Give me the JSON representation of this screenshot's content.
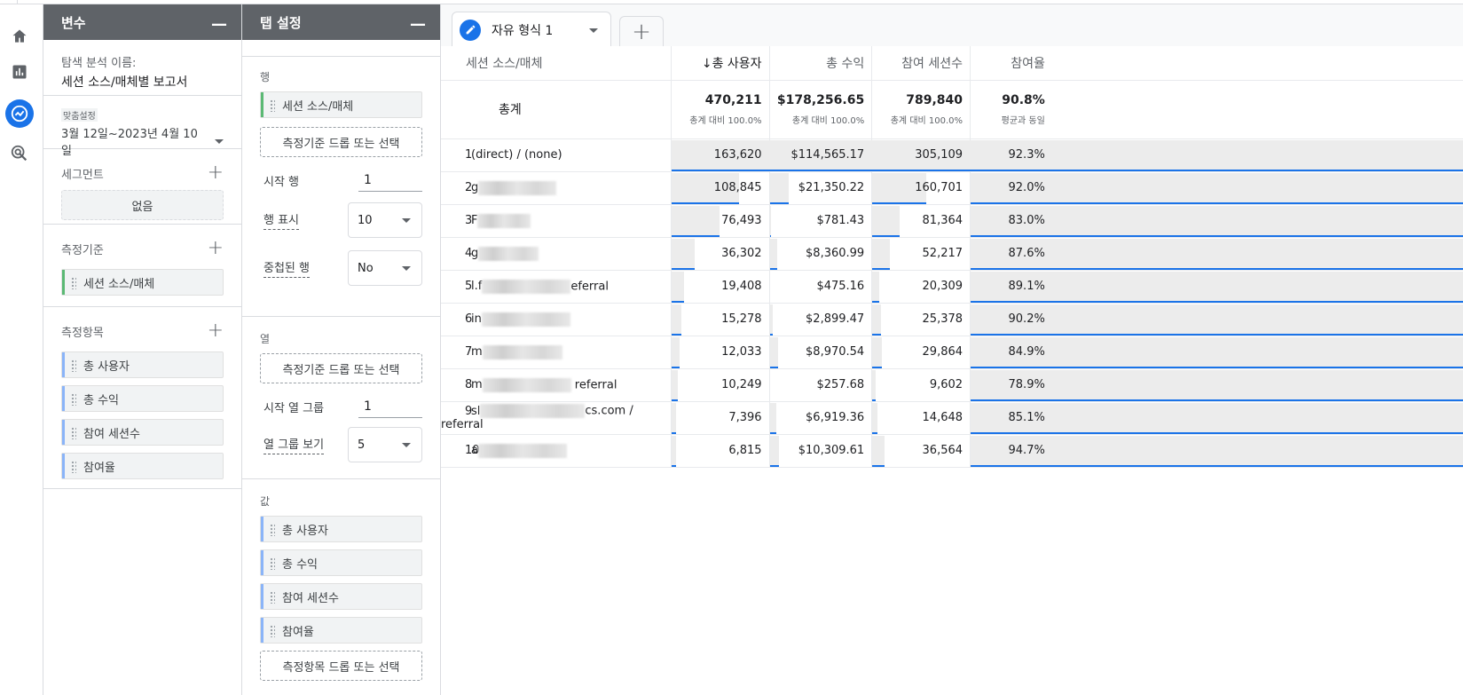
{
  "rail": {
    "items": [
      {
        "icon": "home-icon"
      },
      {
        "icon": "reports-icon"
      },
      {
        "icon": "explore-icon",
        "active": true
      },
      {
        "icon": "advertising-icon"
      }
    ]
  },
  "variables_panel": {
    "title": "변수",
    "collapse": "—",
    "exploration_name_label": "탐색 분석 이름:",
    "exploration_name": "세션 소스/매체별 보고서",
    "date_custom_label": "맞춤설정",
    "date_range": "3월 12일~2023년 4월 10일",
    "segments_label": "세그먼트",
    "segments_empty": "없음",
    "dimensions_label": "측정기준",
    "dimensions": [
      "세션 소스/매체"
    ],
    "metrics_label": "측정항목",
    "metrics": [
      "총 사용자",
      "총 수익",
      "참여 세션수",
      "참여율"
    ]
  },
  "tab_settings_panel": {
    "title": "탭 설정",
    "collapse": "—",
    "rows_label": "행",
    "rows_chip": "세션 소스/매체",
    "drop_dimension": "측정기준 드롭 또는 선택",
    "start_row_label": "시작 행",
    "start_row_value": "1",
    "show_rows_label": "행 표시",
    "show_rows_value": "10",
    "nested_rows_label": "중첩된 행",
    "nested_rows_value": "No",
    "columns_label": "열",
    "drop_dimension_col": "측정기준 드롭 또는 선택",
    "start_col_group_label": "시작 열 그룹",
    "start_col_group_value": "1",
    "show_col_groups_label": "열 그룹 보기",
    "show_col_groups_value": "5",
    "values_label": "값",
    "values": [
      "총 사용자",
      "총 수익",
      "참여 세션수",
      "참여율"
    ],
    "drop_metric": "측정항목 드롭 또는 선택"
  },
  "tabs": {
    "active_tab": "자유 형식 1",
    "add": "+"
  },
  "table": {
    "dimension_header": "세션 소스/매체",
    "metric_headers": [
      "↓총 사용자",
      "총 수익",
      "참여 세션수",
      "참여율"
    ],
    "totals_label": "총계",
    "totals": [
      "470,211",
      "$178,256.65",
      "789,840",
      "90.8%"
    ],
    "totals_sub": [
      "총계 대비 100.0%",
      "총계 대비 100.0%",
      "총계 대비 100.0%",
      "평균과 동일"
    ],
    "rows": [
      {
        "idx": "1",
        "pre": "(direct) / (none)",
        "blur": 0,
        "post": "",
        "v": [
          "163,620",
          "$114,565.17",
          "305,109",
          "92.3%"
        ],
        "f": [
          1.0,
          1.0,
          1.0
        ]
      },
      {
        "idx": "2",
        "pre": "g",
        "blur": 88,
        "post": "",
        "v": [
          "108,845",
          "$21,350.22",
          "160,701",
          "92.0%"
        ],
        "f": [
          0.665,
          0.186,
          0.527
        ]
      },
      {
        "idx": "3",
        "pre": "F",
        "blur": 60,
        "post": "",
        "v": [
          "76,493",
          "$781.43",
          "81,364",
          "83.0%"
        ],
        "f": [
          0.468,
          0.007,
          0.267
        ]
      },
      {
        "idx": "4",
        "pre": "g",
        "blur": 68,
        "post": "",
        "v": [
          "36,302",
          "$8,360.99",
          "52,217",
          "87.6%"
        ],
        "f": [
          0.222,
          0.073,
          0.171
        ]
      },
      {
        "idx": "5",
        "pre": "l.f",
        "blur": 100,
        "post": "eferral",
        "v": [
          "19,408",
          "$475.16",
          "20,309",
          "89.1%"
        ],
        "f": [
          0.119,
          0.004,
          0.067
        ]
      },
      {
        "idx": "6",
        "pre": "in",
        "blur": 100,
        "post": "",
        "v": [
          "15,278",
          "$2,899.47",
          "25,378",
          "90.2%"
        ],
        "f": [
          0.093,
          0.025,
          0.083
        ]
      },
      {
        "idx": "7",
        "pre": "m",
        "blur": 90,
        "post": "",
        "v": [
          "12,033",
          "$8,970.54",
          "29,864",
          "84.9%"
        ],
        "f": [
          0.074,
          0.078,
          0.098
        ]
      },
      {
        "idx": "8",
        "pre": "m",
        "blur": 100,
        "post": " referral",
        "v": [
          "10,249",
          "$257.68",
          "9,602",
          "78.9%"
        ],
        "f": [
          0.063,
          0.002,
          0.031
        ]
      },
      {
        "idx": "9",
        "pre": "sl",
        "blur": 118,
        "post": "cs.com / referral",
        "v": [
          "7,396",
          "$6,919.36",
          "14,648",
          "85.1%"
        ],
        "f": [
          0.045,
          0.06,
          0.048
        ]
      },
      {
        "idx": "10",
        "pre": "a",
        "blur": 100,
        "post": "",
        "v": [
          "6,815",
          "$10,309.61",
          "36,564",
          "94.7%"
        ],
        "f": [
          0.042,
          0.09,
          0.12
        ]
      }
    ]
  }
}
